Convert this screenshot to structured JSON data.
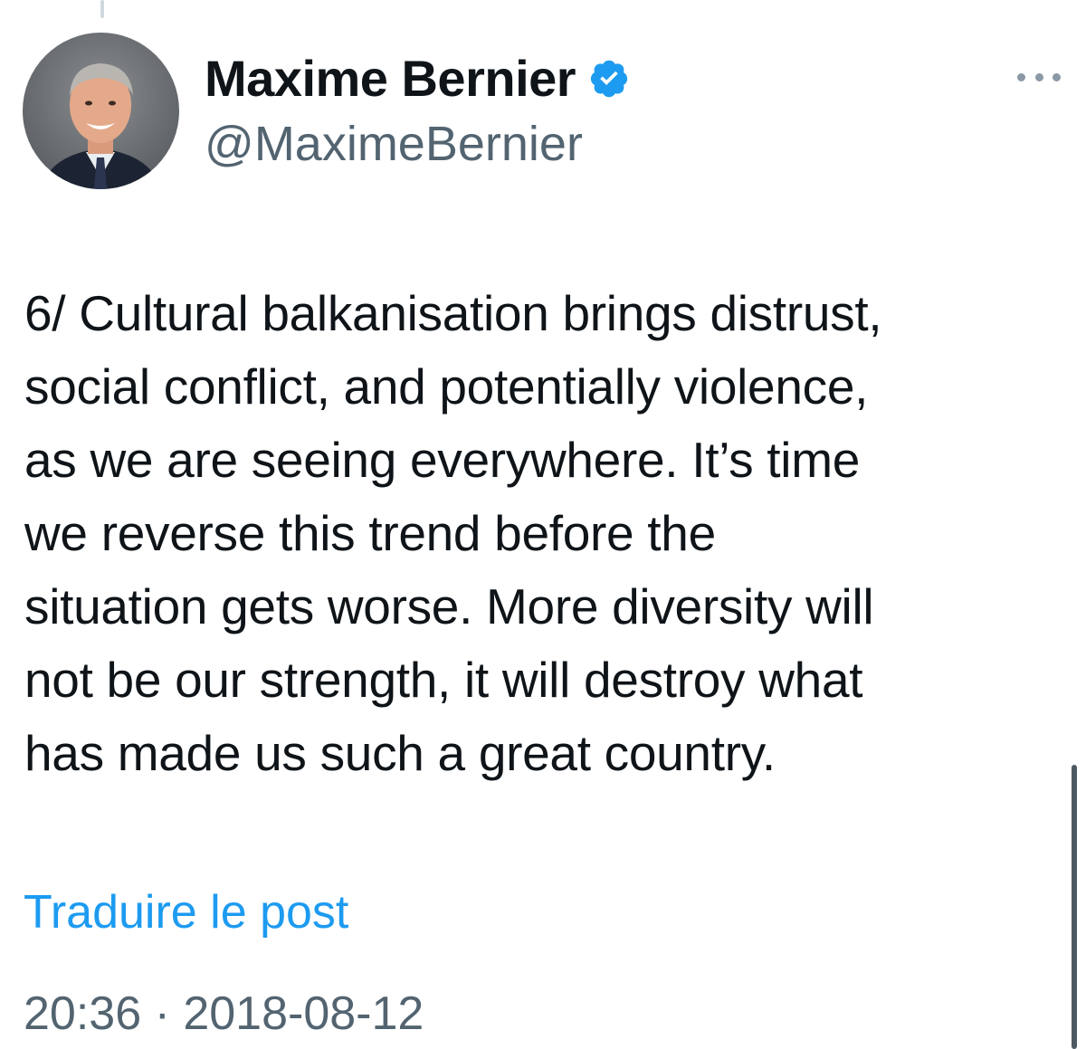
{
  "author": {
    "display_name": "Maxime Bernier",
    "handle": "@MaximeBernier",
    "verified": true
  },
  "tweet": {
    "lines": [
      "6/ Cultural balkanisation brings distrust,",
      "social conflict, and potentially violence,",
      "as we are seeing everywhere. It’s time",
      "we reverse this trend before the",
      "situation gets worse. More diversity will",
      "not be our strength, it will destroy what",
      "has made us such a great country."
    ]
  },
  "translate_link": "Traduire le post",
  "timestamp": "20:36 · 2018-08-12",
  "icons": {
    "verified": "verified-badge-icon",
    "more": "more-options-icon"
  },
  "colors": {
    "link": "#1d9bf0",
    "verified": "#1d9bf0",
    "secondary_text": "#536471"
  }
}
